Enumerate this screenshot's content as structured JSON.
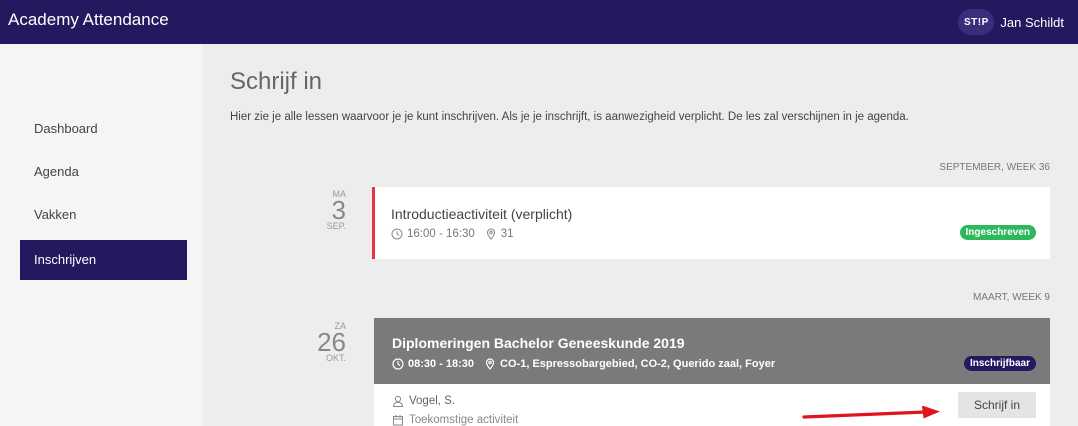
{
  "app": {
    "title": "Academy Attendance"
  },
  "user": {
    "logo_text": "ST!P",
    "name": "Jan Schildt"
  },
  "sidebar": {
    "items": [
      {
        "label": "Dashboard",
        "active": false
      },
      {
        "label": "Agenda",
        "active": false
      },
      {
        "label": "Vakken",
        "active": false
      },
      {
        "label": "Inschrijven",
        "active": true
      }
    ]
  },
  "main": {
    "title": "Schrijf in",
    "intro": "Hier zie je alle lessen waarvoor je je kunt inschrijven. Als je je inschrijft, is aanwezigheid verplicht. De les zal verschijnen in je agenda."
  },
  "weeks": [
    {
      "label": "SEPTEMBER, WEEK 36",
      "event": {
        "dow": "MA",
        "day": "3",
        "month": "SEP.",
        "title": "Introductieactiviteit (verplicht)",
        "time": "16:00 - 16:30",
        "location": "31",
        "status": "Ingeschreven",
        "status_color": "#2eb85c"
      }
    },
    {
      "label": "MAART, WEEK 9",
      "event": {
        "dow": "ZA",
        "day": "26",
        "month": "OKT.",
        "title": "Diplomeringen Bachelor Geneeskunde 2019",
        "time": "08:30 - 18:30",
        "location": "CO-1, Espressobargebied, CO-2, Querido zaal, Foyer",
        "status": "Inschrijfbaar",
        "status_color": "#25185f",
        "teacher": "Vogel, S.",
        "note": "Toekomstige activiteit",
        "action_label": "Schrijf in"
      }
    }
  ],
  "colors": {
    "brand": "#25185f",
    "accent_red": "#e8323c",
    "success": "#2eb85c",
    "arrow": "#e0141e"
  },
  "icons": [
    "clock-icon",
    "location-pin-icon",
    "person-icon",
    "calendar-icon",
    "arrow-icon"
  ]
}
